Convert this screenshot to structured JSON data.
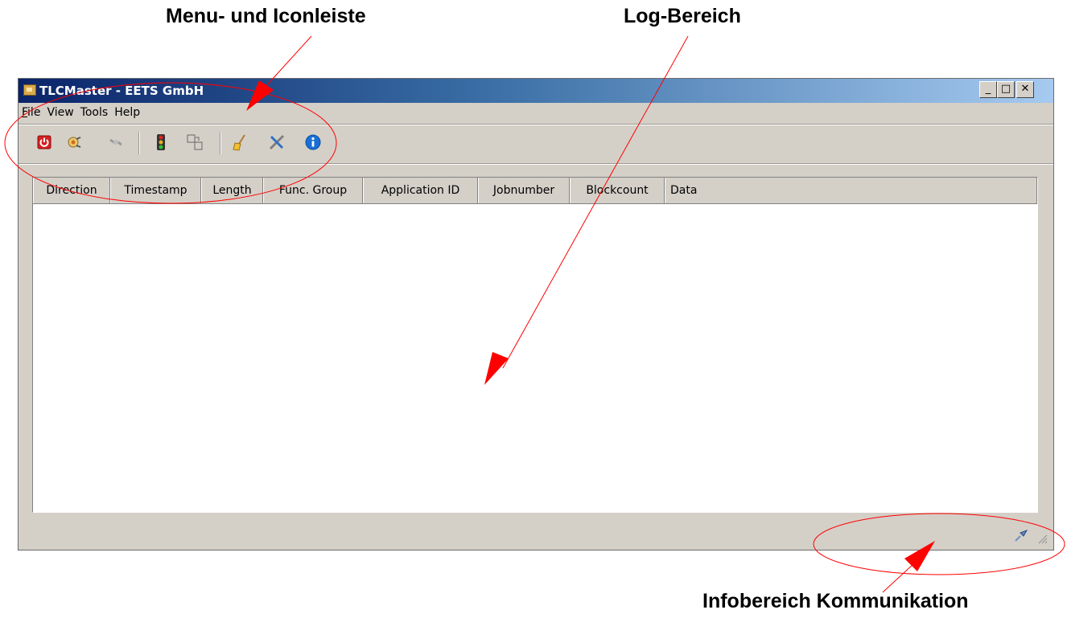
{
  "annotations": {
    "menu_label": "Menu- und Iconleiste",
    "log_label": "Log-Bereich",
    "info_label": "Infobereich Kommunikation"
  },
  "window": {
    "title": "TLCMaster - EETS GmbH",
    "controls": {
      "minimize": "_",
      "maximize": "□",
      "close": "✕"
    }
  },
  "menu": {
    "items": [
      "File",
      "View",
      "Tools",
      "Help"
    ]
  },
  "toolbar": {
    "icons": [
      "power-icon",
      "connect-icon",
      "disconnect-icon",
      "traffic-light-icon",
      "copy-windows-icon",
      "broom-icon",
      "tools-icon",
      "info-icon"
    ]
  },
  "log": {
    "columns": [
      "Direction",
      "Timestamp",
      "Length",
      "Func. Group",
      "Application ID",
      "Jobnumber",
      "Blockcount",
      "Data"
    ]
  },
  "colors": {
    "annotation": "#ff0000",
    "title_gradient_start": "#0a246a",
    "title_gradient_end": "#a6caf0",
    "window_bg": "#d4d0c8"
  }
}
